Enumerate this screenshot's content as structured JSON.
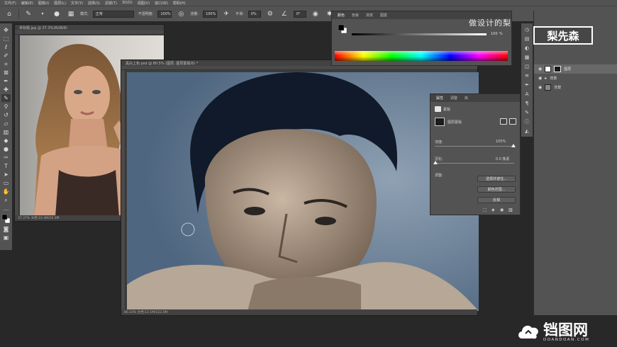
{
  "menubar": {
    "items": [
      "文件(F)",
      "编辑(E)",
      "图像(I)",
      "图层(L)",
      "文字(Y)",
      "选择(S)",
      "滤镜(T)",
      "3D(D)",
      "视图(V)",
      "窗口(W)",
      "帮助(H)"
    ]
  },
  "options_bar": {
    "mode_label": "模式:",
    "mode_value": "正常",
    "opacity_label": "不透明度:",
    "opacity_value": "100%",
    "flow_label": "流量:",
    "flow_value": "100%",
    "smooth_label": "平滑:",
    "smooth_value": "0%",
    "angle_value": "0°"
  },
  "doc_small": {
    "tab": "未标题.jpg @ 37.3%(RGB/8)",
    "status": "37.37%  文档:10.3M/10.3M"
  },
  "doc_main": {
    "tab": "黑白上色.psd @ 80.5% (图层, 图层蒙版/8) *",
    "status": "80.33%  文档:12.1M/122.5M"
  },
  "color_panel": {
    "tabs": [
      "颜色",
      "色板",
      "渐变",
      "图案"
    ],
    "slider_value": "100",
    "slider_unit": "%"
  },
  "properties_panel": {
    "tabs": [
      "属性",
      "调整",
      "库"
    ],
    "type_label": "蒙版",
    "layer_mask_label": "图层蒙版",
    "density_label": "浓度:",
    "density_value": "100%",
    "feather_label": "羽化:",
    "feather_value": "0.0 像素",
    "refine_label": "调整:",
    "btn_select_mask": "选择并遮住...",
    "btn_color_range": "颜色范围...",
    "btn_invert": "反相"
  },
  "layers_panel": {
    "rows": [
      {
        "name": "图层"
      },
      {
        "name": "背景"
      },
      {
        "name": "背景"
      }
    ]
  },
  "overlay": {
    "watermark_title": "做设计的梨",
    "logo_text": "梨先森",
    "site_cn": "铛图网",
    "site_en": "DOANDOAN.COM"
  },
  "colors": {
    "panel": "#535353",
    "dark": "#282828",
    "ui_text": "#c8c8c8",
    "photo_bg": "#6b8198"
  }
}
